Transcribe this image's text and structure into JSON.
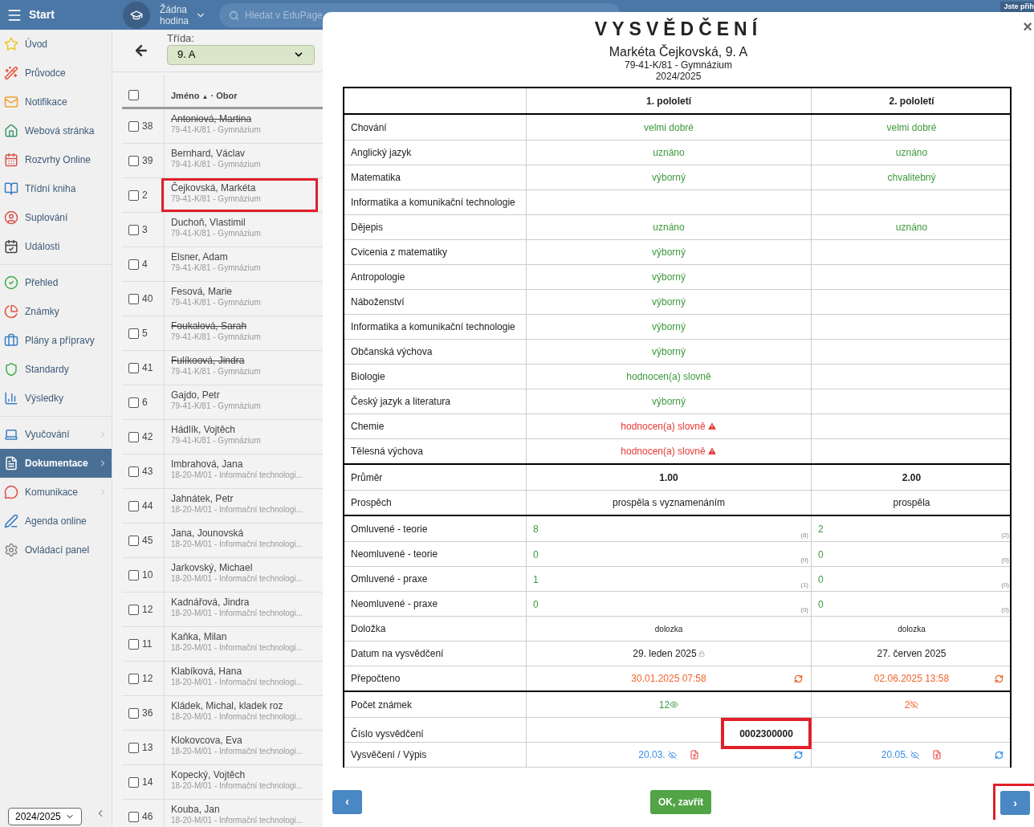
{
  "top_bar": {
    "menu_label": "Start",
    "lesson": [
      "Žádna",
      "hodina"
    ],
    "search": {
      "placeholder": "Hledat v EduPage"
    },
    "login": "Jste přih"
  },
  "sidebar": {
    "groups": [
      [
        {
          "label": "Úvod",
          "selected": false,
          "submenu": false
        },
        {
          "label": "Průvodce",
          "selected": false,
          "submenu": false
        },
        {
          "label": "Notifikace",
          "selected": false,
          "submenu": false
        },
        {
          "label": "Webová stránka",
          "selected": false,
          "submenu": false
        },
        {
          "label": "Rozvrhy Online",
          "selected": false,
          "submenu": false
        },
        {
          "label": "Třídní kniha",
          "selected": false,
          "submenu": false
        },
        {
          "label": "Suplování",
          "selected": false,
          "submenu": false
        },
        {
          "label": "Události",
          "selected": false,
          "submenu": false
        }
      ],
      [
        {
          "label": "Přehled",
          "selected": false,
          "submenu": false
        },
        {
          "label": "Známky",
          "selected": false,
          "submenu": false
        },
        {
          "label": "Plány a přípravy",
          "selected": false,
          "submenu": false
        },
        {
          "label": "Standardy",
          "selected": false,
          "submenu": false
        },
        {
          "label": "Výsledky",
          "selected": false,
          "submenu": false
        }
      ],
      [
        {
          "label": "Vyučování",
          "selected": false,
          "submenu": true
        },
        {
          "label": "Dokumentace",
          "selected": true,
          "submenu": true
        },
        {
          "label": "Komunikace",
          "selected": false,
          "submenu": true
        },
        {
          "label": "Agenda online",
          "selected": false,
          "submenu": false
        },
        {
          "label": "Ovládací panel",
          "selected": false,
          "submenu": false
        }
      ]
    ],
    "year": "2024/2025"
  },
  "students": {
    "class_label": "Třída:",
    "class_value": "9. A",
    "header": {
      "all_checked": false,
      "name": "Jméno",
      "sort": "▲",
      "program": "· Obor"
    },
    "rows": [
      {
        "number": "38",
        "name": "Antoniová, Martina",
        "program": "79-41-K/81 - Gymnázium",
        "crossed_out": true,
        "selected": false
      },
      {
        "number": "39",
        "name": "Bernhard, Václav",
        "program": "79-41-K/81 - Gymnázium",
        "crossed_out": false,
        "selected": false
      },
      {
        "number": "2",
        "name": "Čejkovská, Markéta",
        "program": "79-41-K/81 - Gymnázium",
        "crossed_out": false,
        "selected": true
      },
      {
        "number": "3",
        "name": "Duchoň, Vlastimil",
        "program": "79-41-K/81 - Gymnázium",
        "crossed_out": false,
        "selected": false
      },
      {
        "number": "4",
        "name": "Elsner, Adam",
        "program": "79-41-K/81 - Gymnázium",
        "crossed_out": false,
        "selected": false
      },
      {
        "number": "40",
        "name": "Fesová, Marie",
        "program": "79-41-K/81 - Gymnázium",
        "crossed_out": false,
        "selected": false
      },
      {
        "number": "5",
        "name": "Foukalová, Sarah",
        "program": "79-41-K/81 - Gymnázium",
        "crossed_out": true,
        "selected": false
      },
      {
        "number": "41",
        "name": "Fulíkoová, Jindra",
        "program": "79-41-K/81 - Gymnázium",
        "crossed_out": true,
        "selected": false
      },
      {
        "number": "6",
        "name": "Gajdo, Petr",
        "program": "79-41-K/81 - Gymnázium",
        "crossed_out": false,
        "selected": false
      },
      {
        "number": "42",
        "name": "Hádlík, Vojtěch",
        "program": "79-41-K/81 - Gymnázium",
        "crossed_out": false,
        "selected": false
      },
      {
        "number": "43",
        "name": "Imbrahová, Jana",
        "program": "18-20-M/01 - Informační technologi...",
        "crossed_out": false,
        "selected": false
      },
      {
        "number": "44",
        "name": "Jahnátek, Petr",
        "program": "18-20-M/01 - Informační technologi...",
        "crossed_out": false,
        "selected": false
      },
      {
        "number": "45",
        "name": "Jana, Jounovská",
        "program": "18-20-M/01 - Informační technologi...",
        "crossed_out": false,
        "selected": false
      },
      {
        "number": "10",
        "name": "Jarkovský, Michael",
        "program": "18-20-M/01 - Informační technologi...",
        "crossed_out": false,
        "selected": false
      },
      {
        "number": "12",
        "name": "Kadnářová, Jindra",
        "program": "18-20-M/01 - Informační technologi...",
        "crossed_out": false,
        "selected": false
      },
      {
        "number": "11",
        "name": "Kaňka, Milan",
        "program": "18-20-M/01 - Informační technologi...",
        "crossed_out": false,
        "selected": false
      },
      {
        "number": "12",
        "name": "Klabíková, Hana",
        "program": "18-20-M/01 - Informační technologi...",
        "crossed_out": false,
        "selected": false
      },
      {
        "number": "36",
        "name": "Kládek, Michal, kladek roz",
        "program": "18-20-M/01 - Informační technologi...",
        "crossed_out": false,
        "selected": false
      },
      {
        "number": "13",
        "name": "Klokovcova, Eva",
        "program": "18-20-M/01 - Informační technologi...",
        "crossed_out": false,
        "selected": false
      },
      {
        "number": "14",
        "name": "Kopecký, Vojtěch",
        "program": "18-20-M/01 - Informační technologi...",
        "crossed_out": false,
        "selected": false
      },
      {
        "number": "46",
        "name": "Kouba, Jan",
        "program": "18-20-M/01 - Informační technologi...",
        "crossed_out": false,
        "selected": false
      }
    ]
  },
  "report": {
    "title": "VYSVĚDČENÍ",
    "student": "Markéta Čejkovská, 9. A",
    "program": "79-41-K/81 - Gymnázium",
    "year": "2024/2025",
    "close": "×",
    "columns": [
      "1. pololetí",
      "2. pololetí"
    ],
    "sections": [
      [
        {
          "kind": "grade",
          "label": "Chování",
          "first": {
            "text": "velmi dobré",
            "warning": false
          },
          "second": {
            "text": "velmi dobré",
            "warning": false
          }
        },
        {
          "kind": "grade",
          "label": "Anglický jazyk",
          "first": {
            "text": "uznáno",
            "warning": false
          },
          "second": {
            "text": "uznáno",
            "warning": false
          }
        },
        {
          "kind": "grade",
          "label": "Matematika",
          "first": {
            "text": "výborný",
            "warning": false
          },
          "second": {
            "text": "chvalitebný",
            "warning": false
          }
        },
        {
          "kind": "grade",
          "label": "Informatika a komunikační technologie"
        },
        {
          "kind": "grade",
          "label": "Dějepis",
          "first": {
            "text": "uznáno",
            "warning": false
          },
          "second": {
            "text": "uznáno",
            "warning": false
          }
        },
        {
          "kind": "grade",
          "label": "Cvicenia z matematiky",
          "first": {
            "text": "výborný",
            "warning": false
          }
        },
        {
          "kind": "grade",
          "label": "Antropologie",
          "first": {
            "text": "výborný",
            "warning": false
          }
        },
        {
          "kind": "grade",
          "label": "Náboženství",
          "first": {
            "text": "výborný",
            "warning": false
          }
        },
        {
          "kind": "grade",
          "label": "Informatika a komunikační technologie",
          "first": {
            "text": "výborný",
            "warning": false
          }
        },
        {
          "kind": "grade",
          "label": "Občanská výchova",
          "first": {
            "text": "výborný",
            "warning": false
          }
        },
        {
          "kind": "grade",
          "label": "Biologie",
          "first": {
            "text": "hodnocen(a) slovně",
            "warning": false
          }
        },
        {
          "kind": "grade",
          "label": "Český jazyk a literatura",
          "first": {
            "text": "výborný",
            "warning": false
          }
        },
        {
          "kind": "grade",
          "label": "Chemie",
          "first": {
            "text": "hodnocen(a) slovně",
            "warning": true
          }
        },
        {
          "kind": "grade",
          "label": "Tělesná výchova",
          "first": {
            "text": "hodnocen(a) slovně",
            "warning": true
          }
        }
      ],
      [
        {
          "kind": "summary",
          "label": "Průměr",
          "values": [
            "1.00",
            "2.00"
          ],
          "bold": true
        },
        {
          "kind": "summary",
          "label": "Prospěch",
          "values": [
            "prospěla s vyznamenáním",
            "prospěla"
          ],
          "bold": false
        }
      ],
      [
        {
          "kind": "absence",
          "label": "Omluvené - teorie",
          "values": [
            {
              "count": "8",
              "total": "(8)"
            },
            {
              "count": "2",
              "total": "(2)"
            }
          ]
        },
        {
          "kind": "absence",
          "label": "Neomluvené - teorie",
          "values": [
            {
              "count": "0",
              "total": "(0)"
            },
            {
              "count": "0",
              "total": "(0)"
            }
          ]
        },
        {
          "kind": "absence",
          "label": "Omluvené - praxe",
          "values": [
            {
              "count": "1",
              "total": "(1)"
            },
            {
              "count": "0",
              "total": "(0)"
            }
          ]
        },
        {
          "kind": "absence",
          "label": "Neomluvené - praxe",
          "values": [
            {
              "count": "0",
              "total": "(0)"
            },
            {
              "count": "0",
              "total": "(0)"
            }
          ]
        },
        {
          "kind": "note",
          "label": "Doložka",
          "values": [
            "dolozka",
            "dolozka"
          ]
        },
        {
          "kind": "date",
          "label": "Datum na vysvědčení",
          "values": [
            {
              "text": "29. leden 2025",
              "locked": true
            },
            {
              "text": "27. červen 2025",
              "locked": false
            }
          ]
        },
        {
          "kind": "recalc",
          "label": "Přepočteno",
          "values": [
            "30.01.2025 07:58",
            "02.06.2025 13:58"
          ]
        }
      ],
      [
        {
          "kind": "count",
          "label": "Počet známek",
          "values": [
            {
              "text": "12",
              "visible": true
            },
            {
              "text": "2",
              "visible": false
            }
          ]
        },
        {
          "kind": "number",
          "label": "Číslo vysvědčení",
          "value": "0002300000",
          "highlighted": true
        },
        {
          "kind": "document",
          "label": "Vysvěčení / Výpis",
          "values": [
            "20.03.",
            "20.05."
          ]
        }
      ]
    ],
    "buttons": {
      "previous": "‹",
      "ok": "OK, zavřít",
      "next": "›",
      "next_highlighted": true
    }
  }
}
